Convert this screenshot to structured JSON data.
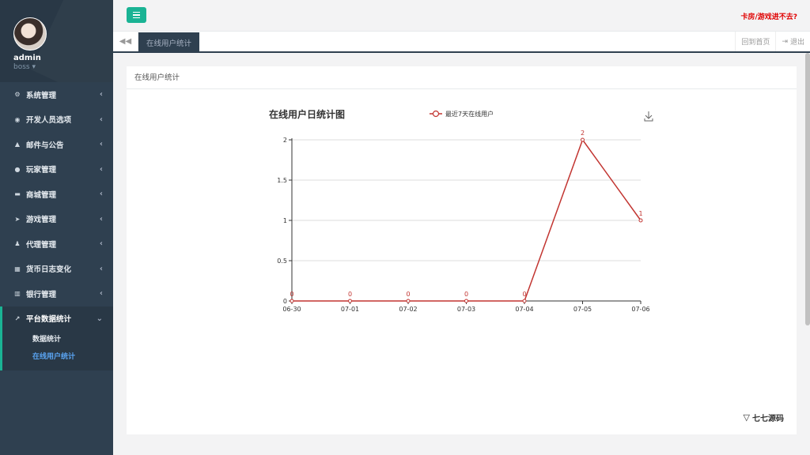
{
  "profile": {
    "name": "admin",
    "role": "boss"
  },
  "menu": [
    {
      "label": "系统管理",
      "icon": "gears-icon"
    },
    {
      "label": "开发人员选项",
      "icon": "gamepad-icon"
    },
    {
      "label": "邮件与公告",
      "icon": "bell-icon"
    },
    {
      "label": "玩家管理",
      "icon": "user-icon"
    },
    {
      "label": "商城管理",
      "icon": "cart-icon"
    },
    {
      "label": "游戏管理",
      "icon": "rocket-icon"
    },
    {
      "label": "代理管理",
      "icon": "agent-icon"
    },
    {
      "label": "货币日志变化",
      "icon": "calendar-icon"
    },
    {
      "label": "银行管理",
      "icon": "bank-icon"
    }
  ],
  "active_menu": {
    "label": "平台数据统计",
    "icon": "line-chart-icon",
    "sub_items": [
      "数据统计",
      "在线用户统计"
    ]
  },
  "topbar": {
    "alert": "卡房/游戏进不去?"
  },
  "tabs": {
    "active": "在线用户统计",
    "home": "回到首页",
    "logout": "退出"
  },
  "panel": {
    "title": "在线用户统计"
  },
  "chart_data": {
    "type": "line",
    "title": "在线用户日统计图",
    "categories": [
      "06-30",
      "07-01",
      "07-02",
      "07-03",
      "07-04",
      "07-05",
      "07-06"
    ],
    "series": [
      {
        "name": "最近7天在线用户",
        "values": [
          0,
          0,
          0,
          0,
          0,
          2,
          1
        ]
      }
    ],
    "ylim": [
      0,
      2
    ],
    "yticks": [
      "0",
      "0.5",
      "1",
      "1.5",
      "2"
    ],
    "grid": true,
    "legend": "top",
    "color": "#c23531"
  },
  "watermark": {
    "text": "七七源码"
  }
}
